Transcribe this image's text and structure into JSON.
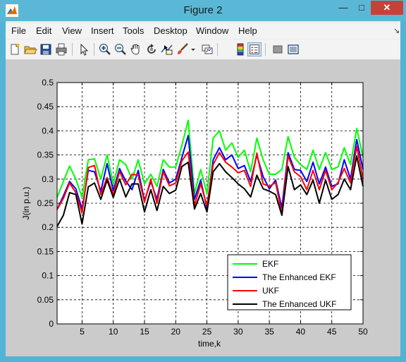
{
  "window": {
    "title": "Figure 2",
    "close_glyph": "✕",
    "minimize_glyph": "—",
    "maximize_glyph": "□"
  },
  "menu": {
    "items": [
      "File",
      "Edit",
      "View",
      "Insert",
      "Tools",
      "Desktop",
      "Window",
      "Help"
    ],
    "dock_glyph": "↘"
  },
  "toolbar": {
    "icons": [
      "new-figure-icon",
      "open-file-icon",
      "save-icon",
      "print-icon",
      "pointer-icon",
      "zoom-in-icon",
      "zoom-out-icon",
      "pan-hand-icon",
      "rotate-3d-icon",
      "data-cursor-icon",
      "brush-icon",
      "brush-dropdown-icon",
      "link-plot-icon",
      "colorbar-icon",
      "legend-icon",
      "hide-plot-tools-icon",
      "show-plot-tools-icon"
    ]
  },
  "chart_data": {
    "type": "line",
    "xlabel": "time,k",
    "ylabel": "J(in p.u.)",
    "xlim": [
      1,
      50
    ],
    "ylim": [
      0,
      0.5
    ],
    "xticks": [
      5,
      10,
      15,
      20,
      25,
      30,
      35,
      40,
      45,
      50
    ],
    "yticks": [
      0,
      0.05,
      0.1,
      0.15,
      0.2,
      0.25,
      0.3,
      0.35,
      0.4,
      0.45,
      0.5
    ],
    "grid": true,
    "legend_position": "bottom-right",
    "x": [
      1,
      2,
      3,
      4,
      5,
      6,
      7,
      8,
      9,
      10,
      11,
      12,
      13,
      14,
      15,
      16,
      17,
      18,
      19,
      20,
      21,
      22,
      23,
      24,
      25,
      26,
      27,
      28,
      29,
      30,
      31,
      32,
      33,
      34,
      35,
      36,
      37,
      38,
      39,
      40,
      41,
      42,
      43,
      44,
      45,
      46,
      47,
      48,
      49,
      50
    ],
    "series": [
      {
        "name": "EKF",
        "color": "#00ff00",
        "values": [
          0.262,
          0.295,
          0.327,
          0.3,
          0.262,
          0.34,
          0.342,
          0.3,
          0.35,
          0.29,
          0.34,
          0.33,
          0.3,
          0.34,
          0.29,
          0.31,
          0.285,
          0.34,
          0.325,
          0.325,
          0.37,
          0.422,
          0.27,
          0.32,
          0.27,
          0.385,
          0.4,
          0.36,
          0.375,
          0.345,
          0.36,
          0.315,
          0.385,
          0.34,
          0.31,
          0.31,
          0.32,
          0.388,
          0.345,
          0.33,
          0.32,
          0.36,
          0.32,
          0.355,
          0.32,
          0.325,
          0.365,
          0.33,
          0.405,
          0.345
        ]
      },
      {
        "name": "The Enhanced EKF",
        "color": "#0000ff",
        "values": [
          0.237,
          0.265,
          0.295,
          0.28,
          0.238,
          0.318,
          0.315,
          0.275,
          0.332,
          0.276,
          0.322,
          0.296,
          0.278,
          0.318,
          0.255,
          0.295,
          0.258,
          0.32,
          0.292,
          0.3,
          0.345,
          0.39,
          0.258,
          0.298,
          0.24,
          0.34,
          0.365,
          0.34,
          0.35,
          0.322,
          0.328,
          0.295,
          0.35,
          0.305,
          0.28,
          0.298,
          0.24,
          0.355,
          0.32,
          0.318,
          0.295,
          0.335,
          0.29,
          0.325,
          0.285,
          0.29,
          0.34,
          0.3,
          0.382,
          0.32
        ]
      },
      {
        "name": "UKF",
        "color": "#ff0000",
        "values": [
          0.237,
          0.26,
          0.292,
          0.272,
          0.23,
          0.324,
          0.328,
          0.268,
          0.303,
          0.268,
          0.316,
          0.288,
          0.31,
          0.308,
          0.252,
          0.3,
          0.25,
          0.315,
          0.286,
          0.292,
          0.338,
          0.356,
          0.245,
          0.29,
          0.245,
          0.33,
          0.355,
          0.335,
          0.325,
          0.313,
          0.318,
          0.285,
          0.354,
          0.29,
          0.285,
          0.293,
          0.228,
          0.348,
          0.315,
          0.305,
          0.278,
          0.318,
          0.278,
          0.318,
          0.278,
          0.293,
          0.322,
          0.292,
          0.368,
          0.3
        ]
      },
      {
        "name": "The Enhanced UKF",
        "color": "#000000",
        "values": [
          0.202,
          0.225,
          0.272,
          0.268,
          0.207,
          0.284,
          0.292,
          0.258,
          0.298,
          0.262,
          0.3,
          0.263,
          0.29,
          0.29,
          0.232,
          0.278,
          0.235,
          0.285,
          0.27,
          0.277,
          0.326,
          0.335,
          0.238,
          0.27,
          0.232,
          0.315,
          0.332,
          0.315,
          0.303,
          0.29,
          0.28,
          0.263,
          0.308,
          0.28,
          0.275,
          0.268,
          0.225,
          0.326,
          0.278,
          0.288,
          0.268,
          0.298,
          0.25,
          0.298,
          0.258,
          0.268,
          0.3,
          0.278,
          0.348,
          0.285
        ]
      }
    ]
  }
}
